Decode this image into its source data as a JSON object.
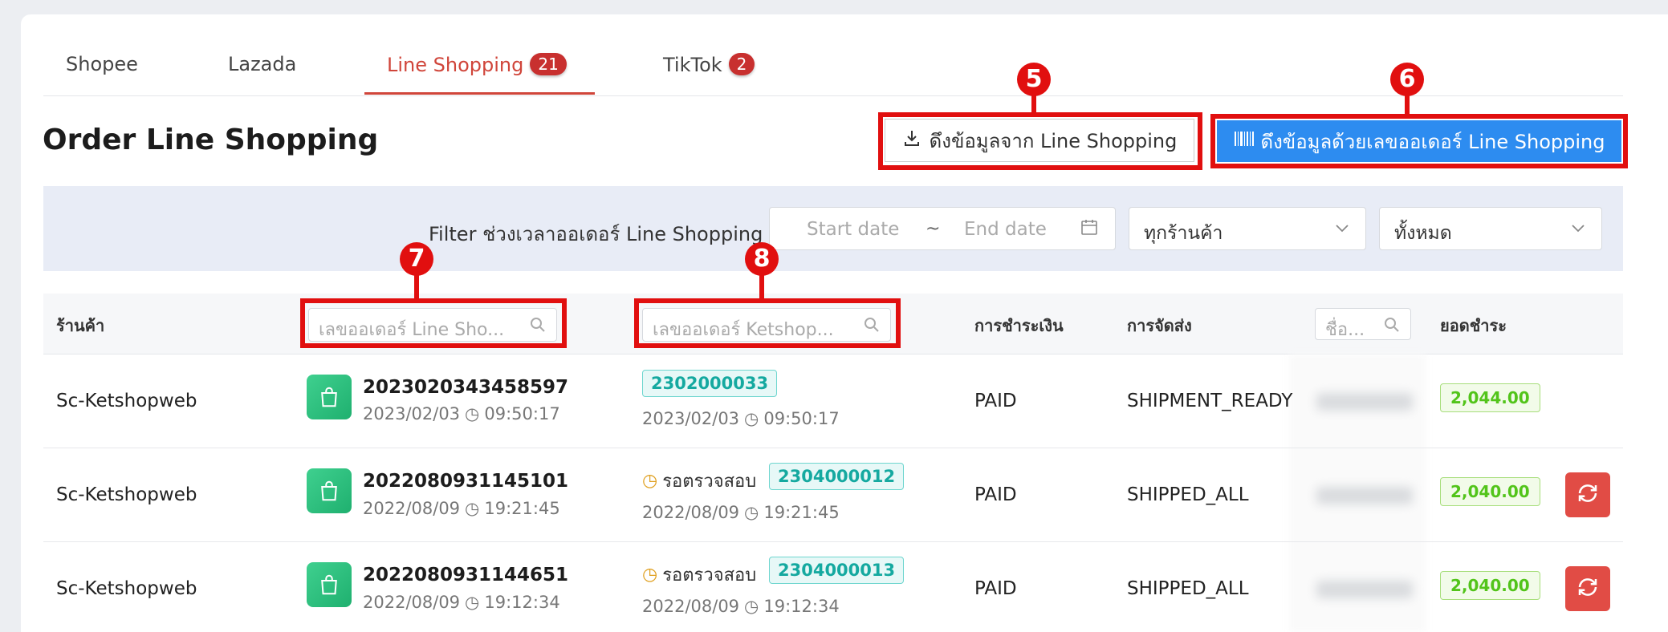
{
  "tabs": [
    {
      "label": "Shopee",
      "badge": ""
    },
    {
      "label": "Lazada",
      "badge": ""
    },
    {
      "label": "Line Shopping",
      "badge": "21"
    },
    {
      "label": "TikTok",
      "badge": "2"
    }
  ],
  "page_title": "Order Line Shopping",
  "buttons": {
    "fetch_label": "ดึงข้อมูลจาก Line Shopping",
    "fetch_by_order_label": "ดึงข้อมูลด้วยเลขออเดอร์ Line Shopping"
  },
  "markers": [
    "5",
    "6",
    "7",
    "8"
  ],
  "filter": {
    "label": "Filter ช่วงเวลาออเดอร์ Line Shopping",
    "start_placeholder": "Start date",
    "separator": "~",
    "end_placeholder": "End date",
    "shop_select": "ทุกร้านค้า",
    "status_select": "ทั้งหมด"
  },
  "table": {
    "headers": {
      "shop": "ร้านค้า",
      "line_order_search": "เลขออเดอร์ Line Sho...",
      "ket_order_search": "เลขออเดอร์ Ketshop...",
      "payment": "การชำระเงิน",
      "shipping": "การจัดส่ง",
      "name_search": "ชื่อ...",
      "total": "ยอดชำระ"
    },
    "rows": [
      {
        "shop": "Sc-Ketshopweb",
        "order_no": "2023020343458597",
        "order_date": "2023/02/03",
        "order_time": "09:50:17",
        "status": "",
        "ket_no": "2302000033",
        "ket_date": "2023/02/03",
        "ket_time": "09:50:17",
        "payment": "PAID",
        "shipping": "SHIPMENT_READY",
        "amount": "2,044.00",
        "refresh": false
      },
      {
        "shop": "Sc-Ketshopweb",
        "order_no": "2022080931145101",
        "order_date": "2022/08/09",
        "order_time": "19:21:45",
        "status": "รอตรวจสอบ",
        "ket_no": "2304000012",
        "ket_date": "2022/08/09",
        "ket_time": "19:21:45",
        "payment": "PAID",
        "shipping": "SHIPPED_ALL",
        "amount": "2,040.00",
        "refresh": true
      },
      {
        "shop": "Sc-Ketshopweb",
        "order_no": "2022080931144651",
        "order_date": "2022/08/09",
        "order_time": "19:12:34",
        "status": "รอตรวจสอบ",
        "ket_no": "2304000013",
        "ket_date": "2022/08/09",
        "ket_time": "19:12:34",
        "payment": "PAID",
        "shipping": "SHIPPED_ALL",
        "amount": "2,040.00",
        "refresh": true
      }
    ]
  },
  "colors": {
    "accent": "#d0453a",
    "primary_button": "#2d8cf0",
    "annotation_red": "#e10f0f",
    "paid_green": "#52c41a",
    "ket_teal": "#15a9a0"
  }
}
